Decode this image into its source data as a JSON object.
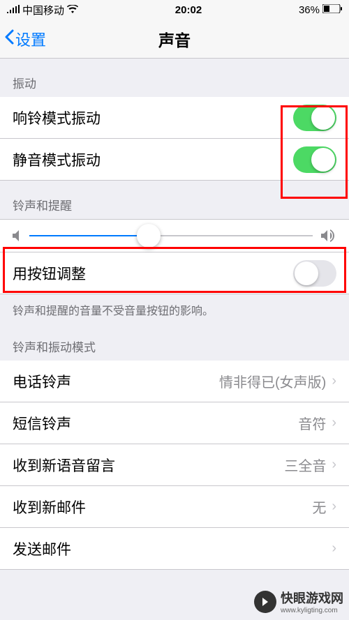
{
  "status": {
    "carrier": "中国移动",
    "time": "20:02",
    "battery_pct": "36%"
  },
  "nav": {
    "back_label": "设置",
    "title": "声音"
  },
  "sections": {
    "vibrate": {
      "header": "振动",
      "ring_vibrate_label": "响铃模式振动",
      "silent_vibrate_label": "静音模式振动"
    },
    "ringer": {
      "header": "铃声和提醒",
      "use_buttons_label": "用按钮调整",
      "footer": "铃声和提醒的音量不受音量按钮的影响。"
    },
    "patterns": {
      "header": "铃声和振动模式",
      "items": [
        {
          "label": "电话铃声",
          "value": "情非得已(女声版)"
        },
        {
          "label": "短信铃声",
          "value": "音符"
        },
        {
          "label": "收到新语音留言",
          "value": "三全音"
        },
        {
          "label": "收到新邮件",
          "value": "无"
        },
        {
          "label": "发送邮件",
          "value": ""
        }
      ]
    }
  },
  "watermark": {
    "name": "快眼游戏网",
    "url": "www.kyligting.com"
  }
}
